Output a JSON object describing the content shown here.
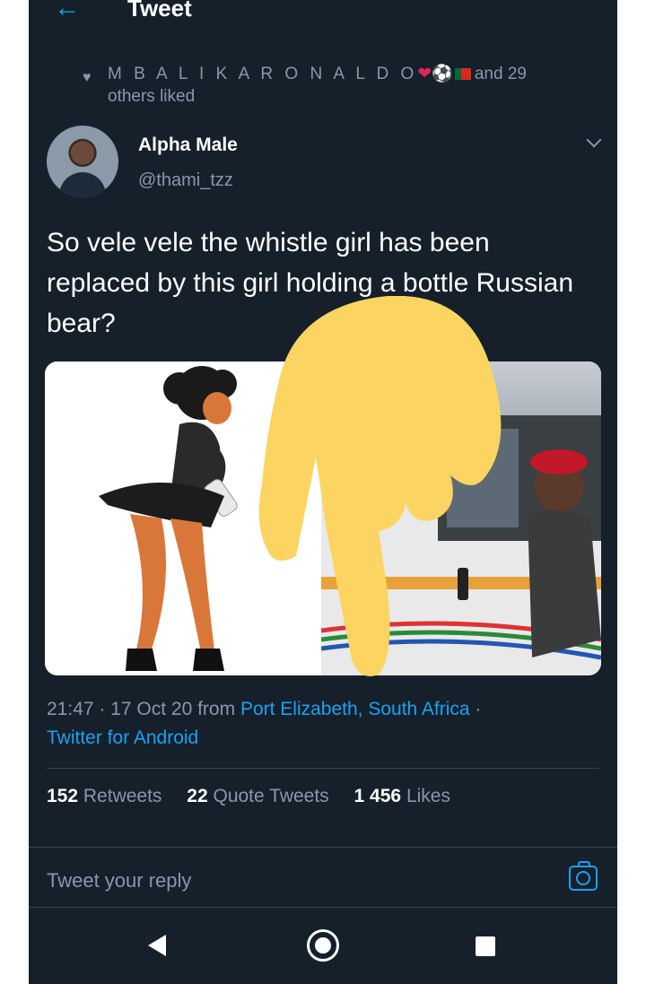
{
  "topbar": {
    "title": "Tweet"
  },
  "liked_by": {
    "name": "M B A L I  K A R O N A L D O",
    "suffix_line1": "and 29",
    "suffix_line2": "others liked"
  },
  "author": {
    "name": "Alpha Male",
    "handle": "@thami_tzz"
  },
  "tweet": {
    "text": "So vele vele the whistle girl has been replaced by this girl holding a bottle Russian bear?"
  },
  "meta": {
    "time_date": "21:47 · 17 Oct 20 from ",
    "location": "Port Elizabeth, South Africa",
    "separator": " ·",
    "client": "Twitter for Android"
  },
  "stats": {
    "retweets_count": "152",
    "retweets_label": "Retweets",
    "quotes_count": "22",
    "quotes_label": "Quote Tweets",
    "likes_count": "1 456",
    "likes_label": "Likes"
  },
  "reply": {
    "placeholder": "Tweet your reply"
  },
  "colors": {
    "background": "#15202b",
    "accent": "#1da1f2",
    "muted_text": "#8899a6",
    "overlay_hand": "#fcd462"
  }
}
